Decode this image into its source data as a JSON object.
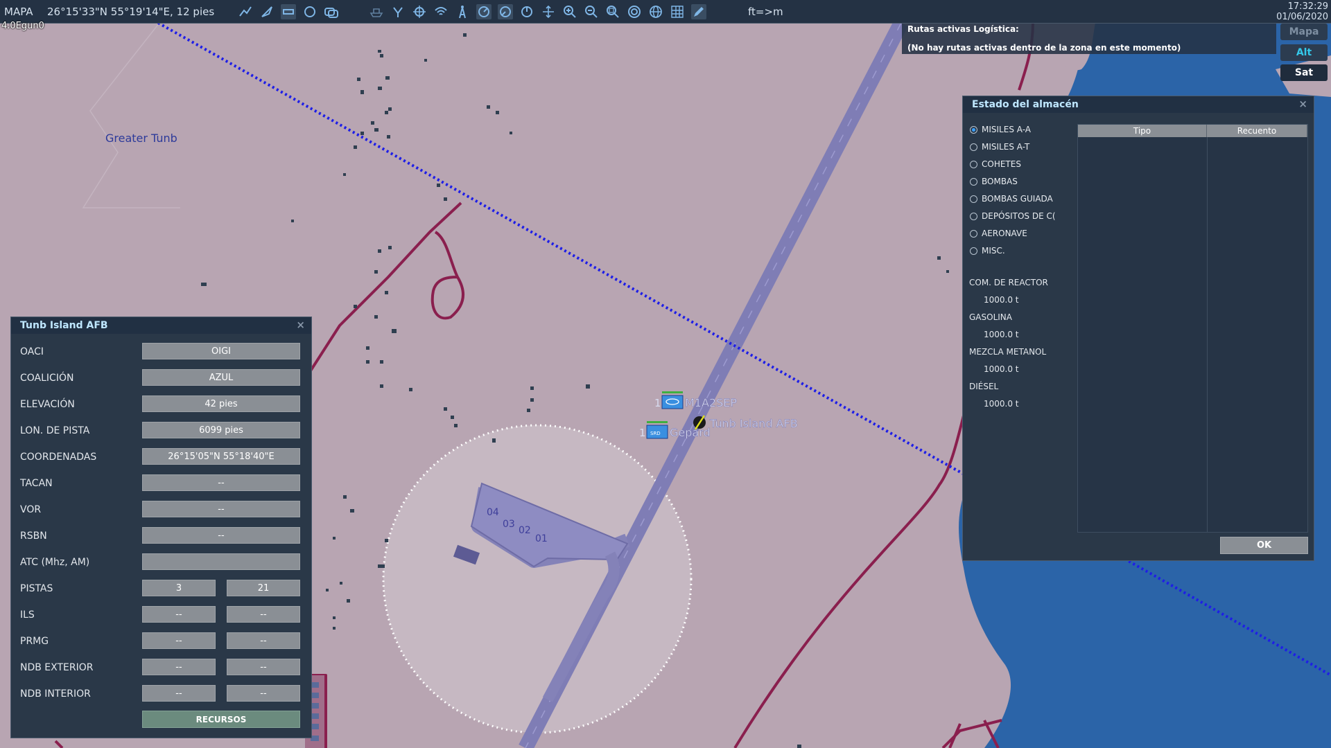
{
  "toolbar": {
    "mode": "MAPA",
    "coordinates": "26°15'33\"N 55°19'14\"E, 12 pies",
    "unit_toggle": "ft=>m",
    "time": "17:32:29",
    "date": "01/06/2020",
    "icons": [
      "route-tool-icon",
      "arrow-tool-icon",
      "rectangle-tool-icon",
      "circle-tool-icon",
      "layers-icon",
      "ships-icon",
      "nodes-icon",
      "crosshair-icon",
      "wifi-icon",
      "radio-tower-icon",
      "radar-icon-1",
      "radar-icon-2",
      "radar-icon-3",
      "move-icon",
      "zoom-in-icon",
      "zoom-out-icon",
      "zoom-fit-icon",
      "target-icon",
      "globe-icon",
      "grid-icon",
      "pen-icon"
    ]
  },
  "scale_label": "4.0Egun0",
  "map": {
    "place_label": "Greater Tunb",
    "airfield_label": "Tunb Island AFB",
    "unit1_label": "M1A2SEP",
    "unit1_count": "1",
    "unit2_label": "Gepard",
    "unit2_count": "1",
    "unit2_badge": "SRD",
    "parking_labels": [
      "04",
      "03",
      "02",
      "01"
    ],
    "colors": {
      "land": "#b8a5b2",
      "sea": "#2b64a8",
      "road": "#8a1f4e",
      "runway": "#8482b8",
      "route": "#1e1ee6"
    }
  },
  "routes_banner": {
    "title": "Rutas activas Logística:",
    "message": "(No hay rutas activas dentro de la zona en este momento)"
  },
  "map_type_buttons": [
    "Mapa",
    "Alt",
    "Sat"
  ],
  "airfield_panel": {
    "title": "Tunb Island AFB",
    "rows": [
      {
        "label": "OACI",
        "values": [
          "OIGI"
        ]
      },
      {
        "label": "COALICIÓN",
        "values": [
          "AZUL"
        ]
      },
      {
        "label": "ELEVACIÓN",
        "values": [
          "42 pies"
        ]
      },
      {
        "label": "LON. DE PISTA",
        "values": [
          "6099 pies"
        ]
      },
      {
        "label": "COORDENADAS",
        "values": [
          "26°15'05\"N 55°18'40\"E"
        ]
      },
      {
        "label": "TACAN",
        "values": [
          "--"
        ]
      },
      {
        "label": "VOR",
        "values": [
          "--"
        ]
      },
      {
        "label": "RSBN",
        "values": [
          "--"
        ]
      },
      {
        "label": "ATC  (Mhz, AM)",
        "values": [
          ""
        ]
      },
      {
        "label": "PISTAS",
        "values": [
          "3",
          "21"
        ]
      },
      {
        "label": "ILS",
        "values": [
          "--",
          "--"
        ]
      },
      {
        "label": "PRMG",
        "values": [
          "--",
          "--"
        ]
      },
      {
        "label": "NDB EXTERIOR",
        "values": [
          "--",
          "--"
        ]
      },
      {
        "label": "NDB INTERIOR",
        "values": [
          "--",
          "--"
        ]
      }
    ],
    "button": "RECURSOS"
  },
  "warehouse_panel": {
    "title": "Estado del almacén",
    "categories": [
      "MISILES A-A",
      "MISILES A-T",
      "COHETES",
      "BOMBAS",
      "BOMBAS GUIADA",
      "DEPÓSITOS DE C(",
      "AERONAVE",
      "MISC."
    ],
    "selected_category": "MISILES A-A",
    "fuels": [
      {
        "label": "COM. DE REACTOR",
        "value": "1000.0 t"
      },
      {
        "label": "GASOLINA",
        "value": "1000.0 t"
      },
      {
        "label": "MEZCLA METANOL",
        "value": "1000.0 t"
      },
      {
        "label": "DIÉSEL",
        "value": "1000.0 t"
      }
    ],
    "columns": [
      "Tipo",
      "Recuento"
    ],
    "ok": "OK"
  }
}
